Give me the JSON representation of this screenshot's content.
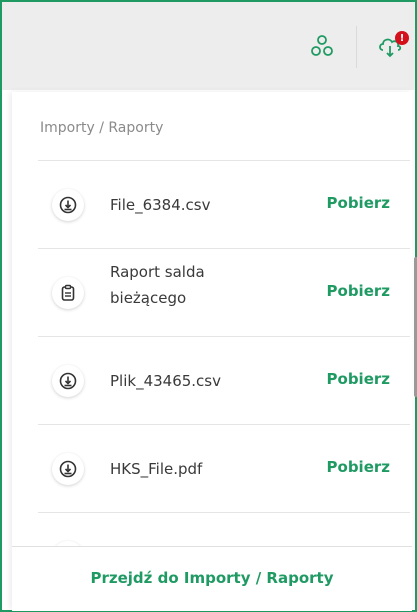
{
  "header": {
    "actions": [
      {
        "icon": "people-icon"
      },
      {
        "icon": "cloud-download-icon",
        "badge": "!"
      }
    ]
  },
  "panel": {
    "title": "Importy / Raporty",
    "items": [
      {
        "icon": "download-icon",
        "name_line1": "File_6384.csv",
        "name_line2": "",
        "action": "Pobierz"
      },
      {
        "icon": "report-icon",
        "name_line1": "Raport salda",
        "name_line2": "bieżącego",
        "action": "Pobierz"
      },
      {
        "icon": "download-icon",
        "name_line1": "Plik_43465.csv",
        "name_line2": "",
        "action": "Pobierz"
      },
      {
        "icon": "download-icon",
        "name_line1": "HKS_File.pdf",
        "name_line2": "",
        "action": "Pobierz"
      }
    ],
    "footer_link": "Przejdź do Importy / Raporty"
  },
  "colors": {
    "accent": "#1f9a63",
    "badge": "#d4111b",
    "topbar": "#ededed"
  }
}
